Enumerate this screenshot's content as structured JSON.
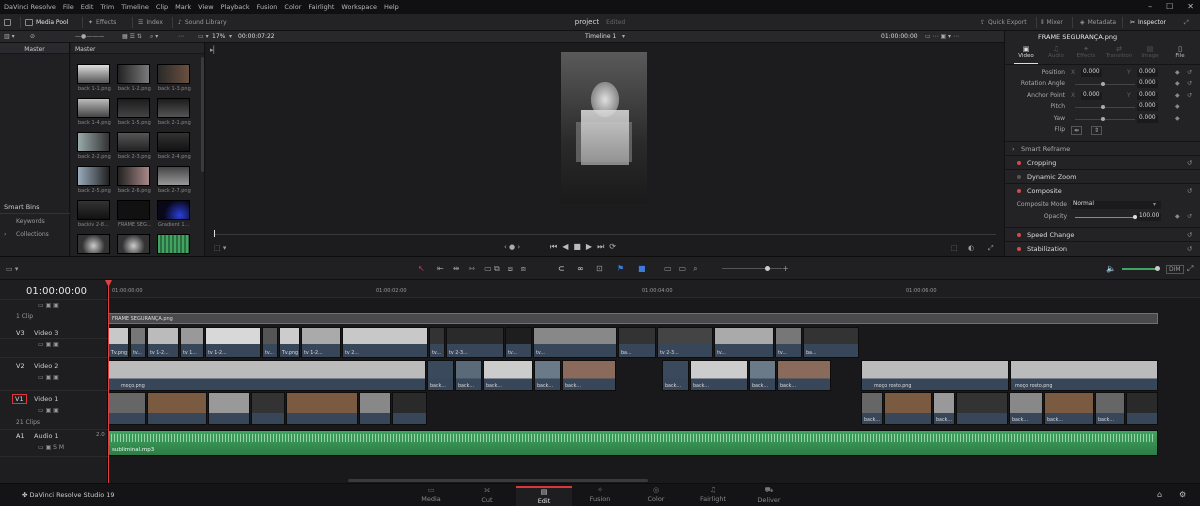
{
  "menubar": {
    "items": [
      "DaVinci Resolve",
      "File",
      "Edit",
      "Trim",
      "Timeline",
      "Clip",
      "Mark",
      "View",
      "Playback",
      "Fusion",
      "Color",
      "Fairlight",
      "Workspace",
      "Help"
    ]
  },
  "toolbar": {
    "media_pool": "Media Pool",
    "effects": "Effects",
    "index": "Index",
    "sound_library": "Sound Library",
    "project_title": "project",
    "project_status": "Edited",
    "quick_export": "Quick Export",
    "mixer": "Mixer",
    "metadata": "Metadata",
    "inspector": "Inspector"
  },
  "subbar": {
    "zoom": "17%",
    "source_tc": "00:00:07:22",
    "timeline_name": "Timeline 1",
    "record_tc": "01:00:00:00"
  },
  "bins": {
    "master": "Master",
    "smart_bins": "Smart Bins",
    "keywords": "Keywords",
    "collections": "Collections"
  },
  "pool": {
    "header": "Master",
    "items": [
      "back 1-1.png",
      "back 1-2.png",
      "back 1-3.png",
      "back 1-4.png",
      "back 1-5.png",
      "back 2-1.png",
      "back 2-2.png",
      "back 2-3.png",
      "back 2-4.png",
      "back 2-5.png",
      "back 2-6.png",
      "back 2-7.png",
      "backiv 2-8...",
      "FRAME SEG...",
      "Gradient 1..."
    ]
  },
  "inspector": {
    "clip_name": "FRAME SEGURANÇA.png",
    "tabs": [
      "Video",
      "Audio",
      "Effects",
      "Transition",
      "Image",
      "File"
    ],
    "position_label": "Position",
    "position_x": "0.000",
    "position_y": "0.000",
    "rotation_label": "Rotation Angle",
    "rotation_val": "0.000",
    "anchor_label": "Anchor Point",
    "anchor_x": "0.000",
    "anchor_y": "0.000",
    "pitch_label": "Pitch",
    "pitch_val": "0.000",
    "yaw_label": "Yaw",
    "yaw_val": "0.000",
    "flip_label": "Flip",
    "smart_reframe": "Smart Reframe",
    "cropping": "Cropping",
    "dynamic_zoom": "Dynamic Zoom",
    "composite": "Composite",
    "composite_mode_label": "Composite Mode",
    "composite_mode_val": "Normal",
    "opacity_label": "Opacity",
    "opacity_val": "100.00",
    "speed_change": "Speed Change",
    "stabilization": "Stabilization"
  },
  "timeline": {
    "timecode": "01:00:00:00",
    "ruler": [
      "01:00:00:00",
      "01:00:02:00",
      "01:00:04:00",
      "01:00:06:00"
    ],
    "tracks": {
      "v4_clips": "1 Clip",
      "v3_code": "V3",
      "v3_name": "Video 3",
      "v2_code": "V2",
      "v2_name": "Video 2",
      "v1_code": "V1",
      "v1_name": "Video 1",
      "v1_clips": "21 Clips",
      "a1_code": "A1",
      "a1_name": "Audio 1",
      "a1_level": "2.0"
    },
    "frame_clip": "FRAME SEGURANÇA.png",
    "v2_clip_a": "moço.png",
    "v2_clip_b": "moço rosto.png",
    "v2_clip_c": "moço rosto.png",
    "v3_labels": [
      "Tv.png",
      "tv...",
      "tv 1-2...",
      "tv 1...",
      "tv 1-2...",
      "tv...",
      "Tv.png",
      "tv 1-2...",
      "tv 2...",
      "tv...",
      "tv 2-3...",
      "tv...",
      "tv...",
      "ba...",
      "tv 2-3...",
      "tv...",
      "tv...",
      "ba..."
    ],
    "v2_labels": [
      "back...",
      "back...",
      "back...",
      "back...",
      "back...",
      "back...",
      "back...",
      "back...",
      "back..."
    ],
    "v1_labels": [
      "back...",
      "back...",
      "back...",
      "back...",
      "back..."
    ],
    "audio_clip": "subliminal.mp3",
    "dim": "DIM",
    "app_name": "DaVinci Resolve Studio 19"
  },
  "pages": [
    "Media",
    "Cut",
    "Edit",
    "Fusion",
    "Color",
    "Fairlight",
    "Deliver"
  ]
}
